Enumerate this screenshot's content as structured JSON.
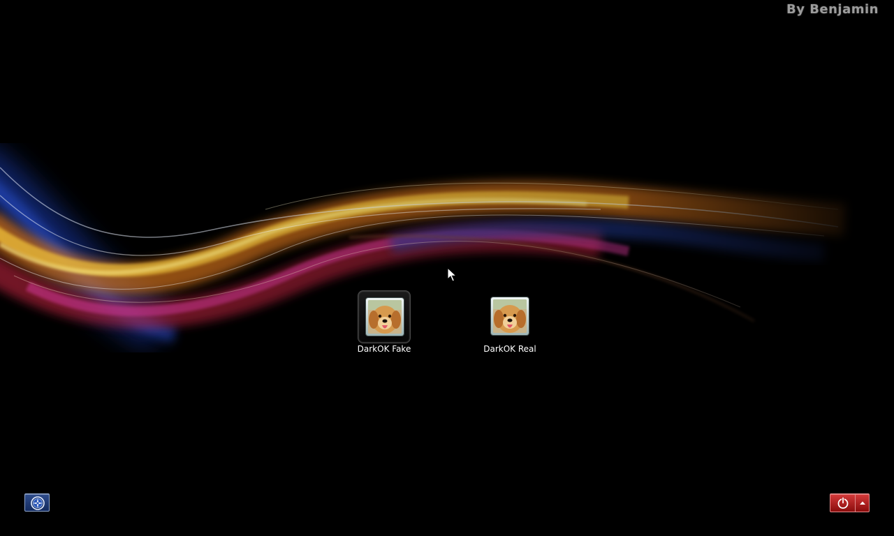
{
  "watermark": "By Benjamin",
  "users": [
    {
      "name": "DarkOK Fake",
      "selected": true,
      "avatar_icon": "dog-avatar-icon"
    },
    {
      "name": "DarkOK Real",
      "selected": false,
      "avatar_icon": "dog-avatar-icon"
    }
  ],
  "buttons": {
    "ease_of_access_icon": "ease-of-access-icon",
    "shutdown_icon": "power-icon",
    "shutdown_options_icon": "chevron-up-icon"
  },
  "colors": {
    "background": "#000000",
    "power_button": "#c42121",
    "ease_button": "#1f3a78",
    "watermark": "#9c9c9c",
    "user_name": "#ffffff"
  }
}
